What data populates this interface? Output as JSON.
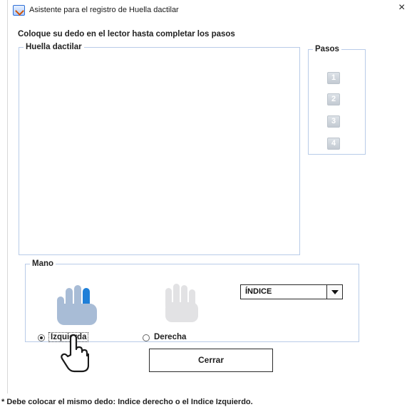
{
  "window": {
    "title": "Asistente para el registro de Huella dactilar",
    "close_glyph": "×",
    "app_icon": "java-window-icon"
  },
  "instruction": "Coloque su dedo en el lector hasta completar los pasos",
  "fingerprint_panel": {
    "legend": "Huella dactilar"
  },
  "steps_panel": {
    "legend": "Pasos",
    "steps": [
      {
        "label": "1",
        "completed": false
      },
      {
        "label": "2",
        "completed": false
      },
      {
        "label": "3",
        "completed": false
      },
      {
        "label": "4",
        "completed": false
      }
    ]
  },
  "hand_panel": {
    "legend": "Mano",
    "left_hand_icon": "left-hand-icon",
    "right_hand_icon": "right-hand-icon",
    "finger_select": {
      "value": "ÍNDICE"
    },
    "options": [
      {
        "label": "Izquierda",
        "selected": true
      },
      {
        "label": "Derecha",
        "selected": false
      }
    ]
  },
  "close_button": {
    "label": "Cerrar"
  },
  "footer_note": "* Debe colocar el mismo dedo: Indice derecho  o el Indice Izquierdo.",
  "colors": {
    "group_border": "#b8cbe8",
    "hand_active": "#a8bcd6",
    "finger_highlight": "#1f7fd8",
    "hand_inactive": "#e2e2e4"
  }
}
